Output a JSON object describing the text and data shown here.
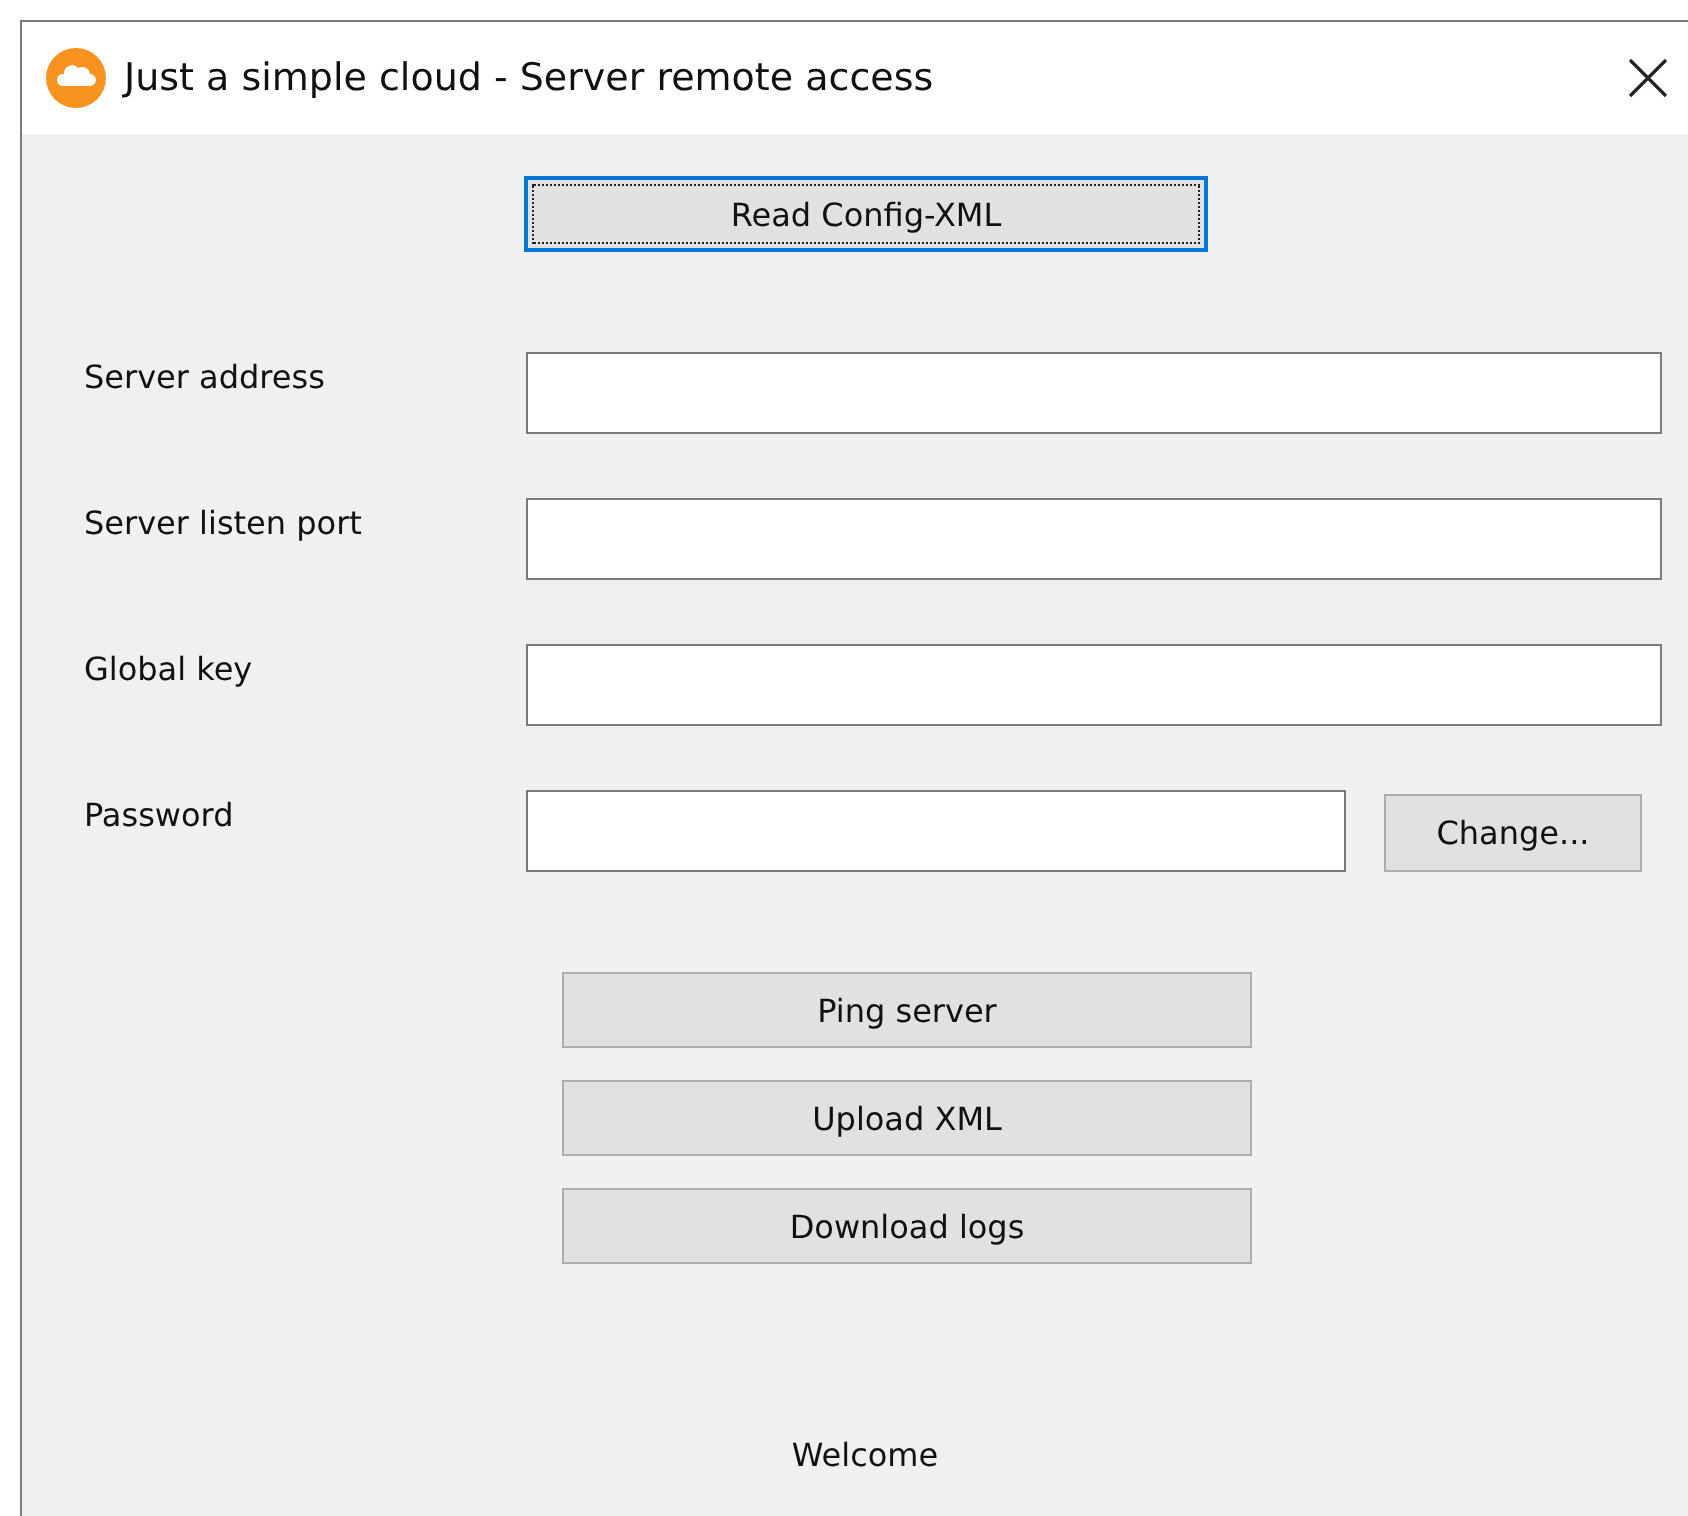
{
  "window": {
    "title": "Just a simple cloud - Server remote access"
  },
  "read_button": {
    "label": "Read Config-XML",
    "focused": true
  },
  "fields": [
    {
      "label": "Server address"
    },
    {
      "label": "Server listen port"
    },
    {
      "label": "Global key"
    },
    {
      "label": "Password",
      "button": "Change..."
    }
  ],
  "actions": [
    "Ping server",
    "Upload XML",
    "Download logs"
  ],
  "status": "Welcome"
}
